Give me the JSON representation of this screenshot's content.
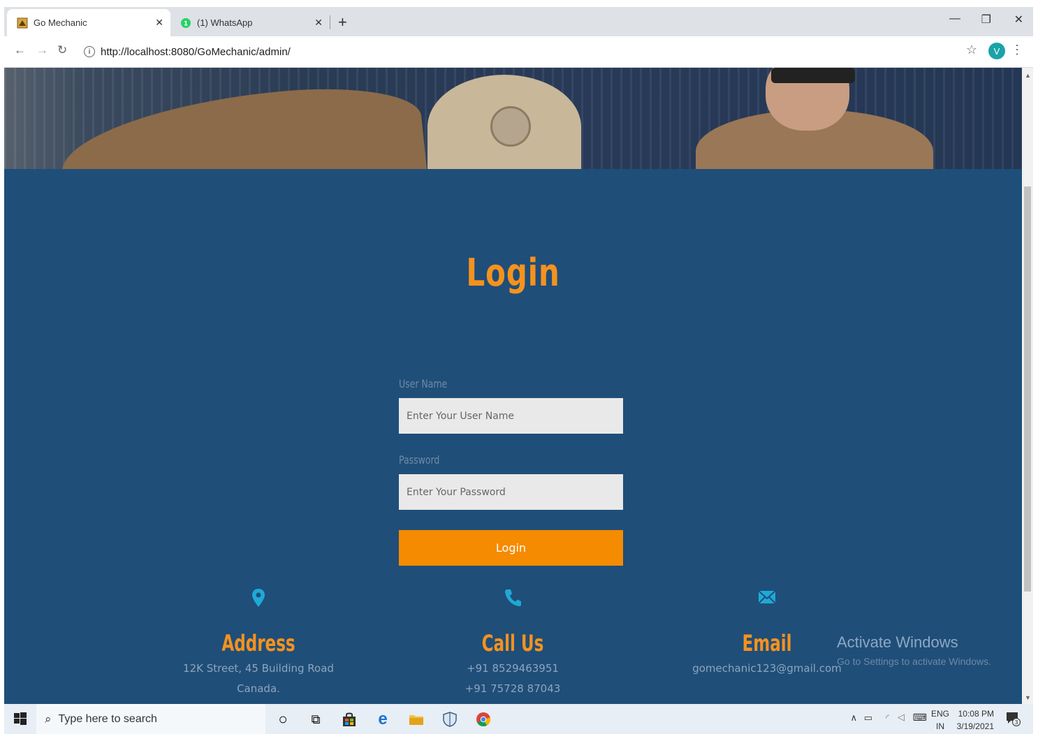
{
  "browser": {
    "tabs": [
      {
        "title": "Go Mechanic",
        "active": true
      },
      {
        "title": "(1) WhatsApp",
        "active": false
      }
    ],
    "new_tab": "+",
    "url": "http://localhost:8080/GoMechanic/admin/",
    "profile_initial": "V"
  },
  "login": {
    "title": "Login",
    "username_label": "User Name",
    "username_placeholder": "Enter Your User Name",
    "password_label": "Password",
    "password_placeholder": "Enter Your Password",
    "submit_label": "Login"
  },
  "contact": {
    "address": {
      "heading": "Address",
      "lines": [
        "12K Street, 45 Building Road",
        "Canada."
      ]
    },
    "call": {
      "heading": "Call Us",
      "lines": [
        "+91 8529463951",
        "+91 75728 87043"
      ]
    },
    "email": {
      "heading": "Email",
      "lines": [
        "gomechanic123@gmail.com"
      ]
    }
  },
  "watermark": {
    "title": "Activate Windows",
    "subtitle": "Go to Settings to activate Windows."
  },
  "taskbar": {
    "search_placeholder": "Type here to search",
    "language": "ENG",
    "region": "IN",
    "time": "10:08 PM",
    "date": "3/19/2021",
    "notifications": "3"
  },
  "colors": {
    "page_bg": "#1f4e79",
    "accent": "#f5921e",
    "button": "#f58b00",
    "icon": "#1fa9d6"
  }
}
